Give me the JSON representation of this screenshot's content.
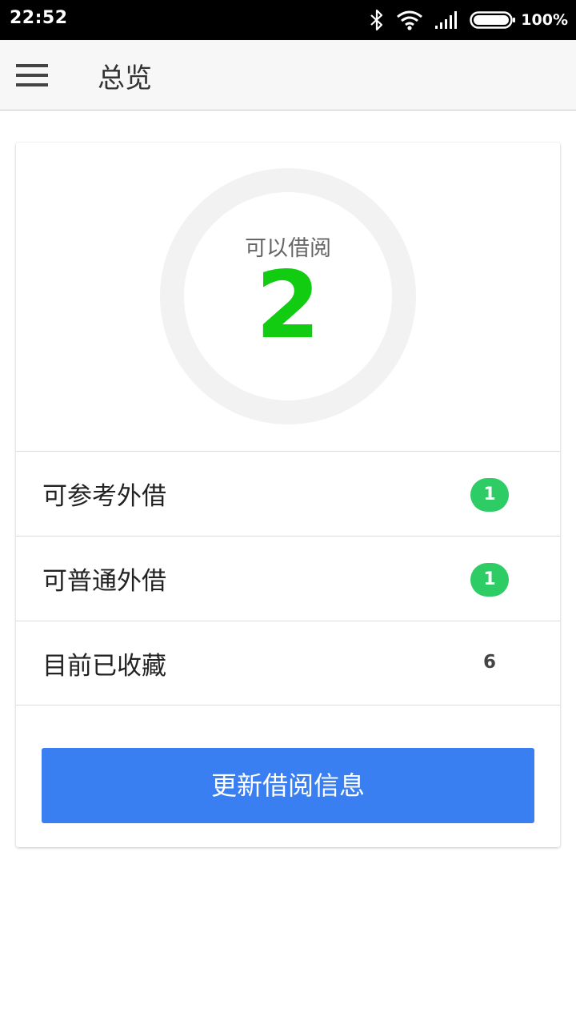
{
  "status_bar": {
    "time": "22:52",
    "battery_percent": "100%",
    "icons": [
      "bluetooth-icon",
      "wifi-icon",
      "signal-icon",
      "battery-icon"
    ]
  },
  "app_bar": {
    "menu_icon": "menu-icon",
    "title": "总览"
  },
  "summary": {
    "label": "可以借阅",
    "value": "2",
    "value_color": "#11cc11"
  },
  "stats": [
    {
      "label": "可参考外借",
      "count": "1",
      "style": "badge"
    },
    {
      "label": "可普通外借",
      "count": "1",
      "style": "badge"
    },
    {
      "label": "目前已收藏",
      "count": "6",
      "style": "plain"
    }
  ],
  "actions": {
    "refresh_label": "更新借阅信息"
  },
  "colors": {
    "accent": "#3a7ff2",
    "badge": "#2ecc65",
    "status_bar": "#000000"
  }
}
